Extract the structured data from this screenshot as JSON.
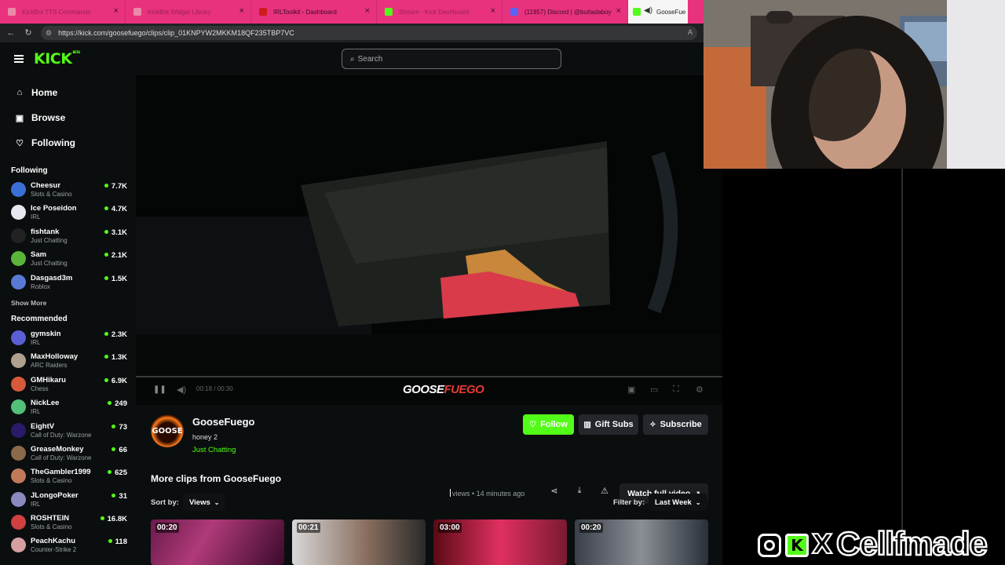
{
  "browser": {
    "tabs": [
      {
        "label": "KickBot TTS Commands",
        "color": "#e88aa8",
        "faded": true
      },
      {
        "label": "KickBot Widget Library",
        "color": "#e88aa8",
        "faded": true
      },
      {
        "label": "IRLToolkit - Dashboard",
        "color": "#d01c1c",
        "faded": false
      },
      {
        "label": "Stream - Kick Dashboard",
        "color": "#53fc18",
        "faded": true
      },
      {
        "label": "(11957) Discord | @buttadaboy",
        "color": "#5865f2",
        "faded": false
      }
    ],
    "active_tab": "GooseFue",
    "url": "https://kick.com/goosefuego/clips/clip_01KNPYW2MKKM18QF235TBP7VC"
  },
  "kick": {
    "logo": "KICK",
    "logo_badge": "BETA",
    "search_placeholder": "Search",
    "nav": [
      {
        "label": "Home",
        "icon": "home-icon"
      },
      {
        "label": "Browse",
        "icon": "browse-icon"
      },
      {
        "label": "Following",
        "icon": "heart-icon"
      }
    ],
    "following_header": "Following",
    "following": [
      {
        "name": "Cheesur",
        "category": "Slots & Casino",
        "viewers": "7.7K",
        "color": "#3b6fd6"
      },
      {
        "name": "Ice Poseidon",
        "category": "IRL",
        "viewers": "4.7K",
        "color": "#e8e8f0"
      },
      {
        "name": "fishtank",
        "category": "Just Chatting",
        "viewers": "3.1K",
        "color": "#222"
      },
      {
        "name": "Sam",
        "category": "Just Chatting",
        "viewers": "2.1K",
        "color": "#5ab53a"
      },
      {
        "name": "Dasgasd3m",
        "category": "Roblox",
        "viewers": "1.5K",
        "color": "#5a7ad6"
      }
    ],
    "show_more": "Show More",
    "recommended_header": "Recommended",
    "recommended": [
      {
        "name": "gymskin",
        "category": "IRL",
        "viewers": "2.3K",
        "color": "#5a5fd6"
      },
      {
        "name": "MaxHolloway",
        "category": "ARC Raiders",
        "viewers": "1.3K",
        "color": "#b0a090"
      },
      {
        "name": "GMHikaru",
        "category": "Chess",
        "viewers": "6.9K",
        "color": "#d65a3a"
      },
      {
        "name": "NickLee",
        "category": "IRL",
        "viewers": "249",
        "color": "#53c07a"
      },
      {
        "name": "EightV",
        "category": "Call of Duty: Warzone",
        "viewers": "73",
        "color": "#2a1a6a"
      },
      {
        "name": "GreaseMonkey",
        "category": "Call of Duty: Warzone",
        "viewers": "66",
        "color": "#8a6a4a"
      },
      {
        "name": "TheGambler1999",
        "category": "Slots & Casino",
        "viewers": "625",
        "color": "#c07a5a"
      },
      {
        "name": "JLongoPoker",
        "category": "IRL",
        "viewers": "31",
        "color": "#8a8ac0"
      },
      {
        "name": "ROSHTEIN",
        "category": "Slots & Casino",
        "viewers": "16.8K",
        "color": "#d04040"
      },
      {
        "name": "PeachKachu",
        "category": "Counter-Strike 2",
        "viewers": "118",
        "color": "#d6a0a0"
      }
    ],
    "player": {
      "time": "00:18 / 00:30",
      "progress": 0.0,
      "watermark_a": "GOOSE",
      "watermark_b": "FUEGO"
    },
    "clip": {
      "channel": "GooseFuego",
      "avatar_text": "GOOSE",
      "title": "honey 2",
      "category": "Just Chatting",
      "follow": "Follow",
      "gift": "Gift Subs",
      "subscribe": "Subscribe",
      "views": "views",
      "ago": "14 minutes ago",
      "watch_full": "Watch full video"
    },
    "more_clips_title": "More clips from GooseFuego",
    "sort_label": "Sort by:",
    "sort_value": "Views",
    "filter_label": "Filter by:",
    "filter_value": "Last Week",
    "thumbs": [
      {
        "duration": "00:20"
      },
      {
        "duration": "00:21"
      },
      {
        "duration": "03:00"
      },
      {
        "duration": "00:20"
      }
    ]
  },
  "overlay": {
    "brand_x": "X",
    "brand_name": "Cellfmade",
    "brand_k": "K"
  }
}
